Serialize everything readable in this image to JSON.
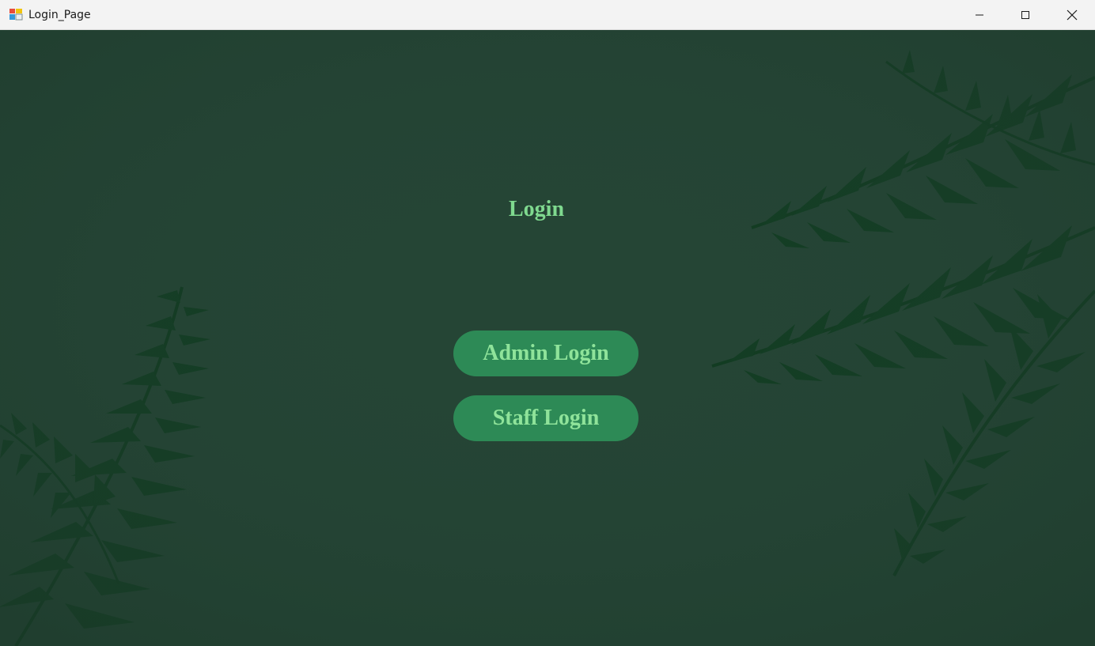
{
  "window": {
    "title": "Login_Page",
    "icon": "winforms-app-icon",
    "controls": [
      "minimize-icon",
      "maximize-icon",
      "close-icon"
    ]
  },
  "main": {
    "heading": "Login",
    "buttons": {
      "admin_label": "Admin Login",
      "staff_label": "Staff Login"
    }
  },
  "colors": {
    "background": "#254535",
    "leaf": "#0f3a1f",
    "button_fill": "#2d8a56",
    "text_green": "#7fd98f"
  }
}
